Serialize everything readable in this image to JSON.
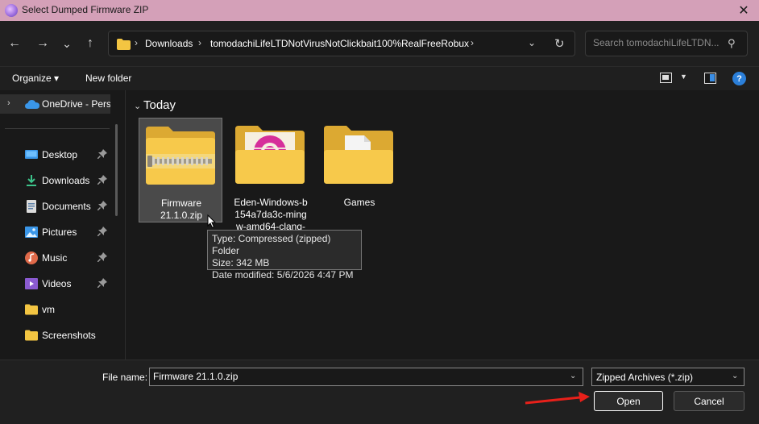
{
  "window": {
    "title": "Select Dumped Firmware ZIP",
    "close_glyph": "✕"
  },
  "nav": {
    "back_glyph": "←",
    "forward_glyph": "→",
    "recent_glyph": "⌄",
    "up_glyph": "↑"
  },
  "breadcrumb": {
    "sep": "›",
    "items": [
      "Downloads",
      "tomodachiLifeLTDNotVirusNotClickbait100%RealFreeRobux"
    ],
    "dropdown_glyph": "⌄",
    "refresh_glyph": "↻"
  },
  "search": {
    "placeholder": "Search tomodachiLifeLTDN...",
    "icon_glyph": "⚲"
  },
  "toolbar": {
    "organize_label": "Organize ▾",
    "new_folder_label": "New folder",
    "view_dd_glyph": "▼",
    "help_glyph": "?"
  },
  "sidebar": {
    "onedrive_label": "OneDrive - Perso",
    "expand_glyph": "›",
    "items": [
      {
        "label": "Desktop",
        "icon": "desktop-icon",
        "pinned": true
      },
      {
        "label": "Downloads",
        "icon": "downloads-icon",
        "pinned": true
      },
      {
        "label": "Documents",
        "icon": "documents-icon",
        "pinned": true
      },
      {
        "label": "Pictures",
        "icon": "pictures-icon",
        "pinned": true
      },
      {
        "label": "Music",
        "icon": "music-icon",
        "pinned": true
      },
      {
        "label": "Videos",
        "icon": "videos-icon",
        "pinned": true
      },
      {
        "label": "vm",
        "icon": "folder-icon",
        "pinned": false
      },
      {
        "label": "Screenshots",
        "icon": "folder-icon",
        "pinned": false
      }
    ]
  },
  "main": {
    "group_title": "Today",
    "group_chevron": "⌄",
    "files": [
      {
        "name": "Firmware 21.1.0.zip",
        "name_lines": [
          "Firmware",
          "21.1.0.zip"
        ],
        "icon": "zip-folder-icon",
        "selected": true
      },
      {
        "name": "Eden-Windows-b154a7da3c-mingw-amd64-clang-",
        "name_lines": [
          "Eden-Windows-b",
          "154a7da3c-ming",
          "w-amd64-clang-"
        ],
        "icon": "eden-folder-icon",
        "selected": false
      },
      {
        "name": "Games",
        "name_lines": [
          "Games"
        ],
        "icon": "games-folder-icon",
        "selected": false
      }
    ]
  },
  "tooltip": {
    "type": "Type: Compressed (zipped) Folder",
    "size": "Size: 342 MB",
    "date": "Date modified: 5/6/2026 4:47 PM"
  },
  "footer": {
    "filename_label": "File name:",
    "filename_value": "Firmware 21.1.0.zip",
    "filetype_value": "Zipped Archives (*.zip)",
    "dd_glyph": "⌄",
    "open_label": "Open",
    "cancel_label": "Cancel"
  },
  "colors": {
    "titlebar": "#d4a0b8",
    "folder_yellow": "#f3c542",
    "accent_blue": "#2b7fd9",
    "annotation_arrow": "#e8201a"
  }
}
